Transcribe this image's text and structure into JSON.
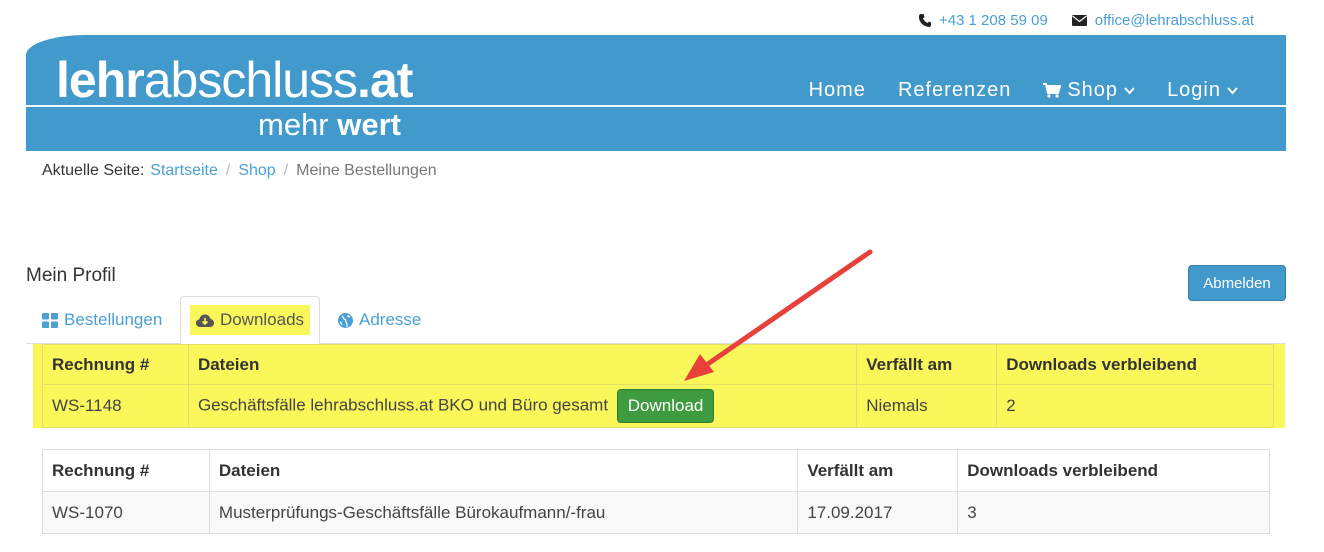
{
  "contact": {
    "phone": "+43 1 208 59 09",
    "email": "office@lehrabschluss.at",
    "phone_icon": "phone-icon",
    "email_icon": "envelope-icon"
  },
  "logo": {
    "bold": "lehr",
    "light": "abschluss",
    "tld": ".at",
    "sub_light": "mehr ",
    "sub_bold": "wert"
  },
  "nav": {
    "home": "Home",
    "references": "Referenzen",
    "shop": "Shop",
    "login": "Login"
  },
  "breadcrumb": {
    "prefix": "Aktuelle Seite:",
    "items": [
      "Startseite",
      "Shop"
    ],
    "current": "Meine Bestellungen"
  },
  "profile": {
    "title": "Mein Profil",
    "logout": "Abmelden"
  },
  "tabs": [
    {
      "label": "Bestellungen",
      "icon": "grid-icon"
    },
    {
      "label": "Downloads",
      "icon": "cloud-download-icon",
      "active": true
    },
    {
      "label": "Adresse",
      "icon": "globe-icon"
    }
  ],
  "table1": {
    "headers": [
      "Rechnung #",
      "Dateien",
      "Verfällt am",
      "Downloads verbleibend"
    ],
    "row": {
      "invoice": "WS-1148",
      "file": "Geschäftsfälle lehrabschluss.at BKO und Büro gesamt",
      "button": "Download",
      "expires": "Niemals",
      "remaining": "2"
    }
  },
  "table2": {
    "headers": [
      "Rechnung #",
      "Dateien",
      "Verfällt am",
      "Downloads verbleibend"
    ],
    "row": {
      "invoice": "WS-1070",
      "file": "Musterprüfungs-Geschäftsfälle Bürokaufmann/-frau",
      "expires": "17.09.2017",
      "remaining": "3"
    }
  },
  "colors": {
    "header": "#4199cc",
    "highlight": "#faf75a",
    "download_button": "#3f9b3f",
    "arrow": "#e8413b",
    "link": "#4a9fd4"
  }
}
